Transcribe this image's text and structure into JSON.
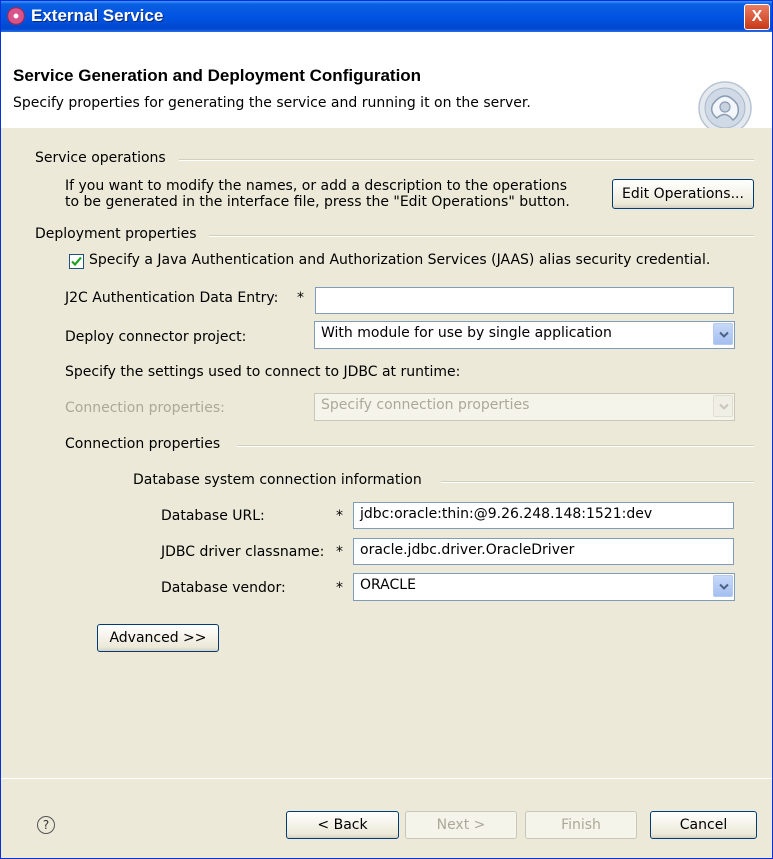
{
  "window": {
    "title": "External Service",
    "close_glyph": "X"
  },
  "header": {
    "title": "Service Generation and Deployment Configuration",
    "description": "Specify properties for generating the service and running it on the server.",
    "icon": "wizard-gear-icon"
  },
  "service_operations": {
    "group_label": "Service operations",
    "line1": "If you want to modify the names, or add a description to the operations",
    "line2": "to be generated in the interface file, press the \"Edit Operations\" button.",
    "edit_button": "Edit Operations..."
  },
  "deployment": {
    "group_label": "Deployment properties",
    "jaas_checkbox_label": "Specify a Java Authentication and Authorization Services (JAAS) alias security credential.",
    "jaas_checked": true,
    "j2c_label": "J2C Authentication Data Entry:",
    "j2c_required": "*",
    "j2c_value": "",
    "deploy_label": "Deploy connector project:",
    "deploy_value": "With module for use by single application",
    "jdbc_settings_text": "Specify the settings used to connect to JDBC at runtime:",
    "conn_props_label": "Connection properties:",
    "conn_props_value": "Specify connection properties"
  },
  "connection": {
    "group_label": "Connection properties",
    "db_group_label": "Database system connection information",
    "url_label": "Database URL:",
    "url_value": "jdbc:oracle:thin:@9.26.248.148:1521:dev",
    "driver_label": "JDBC driver classname:",
    "driver_value": "oracle.jdbc.driver.OracleDriver",
    "vendor_label": "Database vendor:",
    "vendor_value": "ORACLE",
    "required_marker": "*",
    "advanced_button": "Advanced >>"
  },
  "footer": {
    "help_glyph": "?",
    "back": "< Back",
    "next": "Next >",
    "finish": "Finish",
    "cancel": "Cancel"
  }
}
